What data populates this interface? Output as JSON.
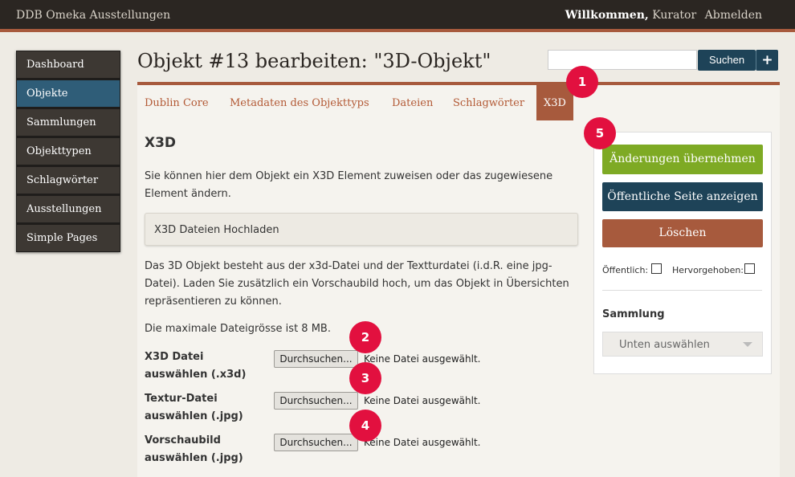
{
  "header": {
    "site_title": "DDB Omeka Ausstellungen",
    "welcome": "Willkommen,",
    "user": "Kurator",
    "logout": "Abmelden"
  },
  "nav": {
    "items": [
      {
        "label": "Dashboard",
        "active": false
      },
      {
        "label": "Objekte",
        "active": true
      },
      {
        "label": "Sammlungen",
        "active": false
      },
      {
        "label": "Objekttypen",
        "active": false
      },
      {
        "label": "Schlagwörter",
        "active": false
      },
      {
        "label": "Ausstellungen",
        "active": false
      },
      {
        "label": "Simple Pages",
        "active": false
      }
    ]
  },
  "page": {
    "title": "Objekt #13 bearbeiten: \"3D-Objekt\""
  },
  "search": {
    "value": "",
    "button": "Suchen",
    "add": "+"
  },
  "tabs": [
    {
      "label": "Dublin Core",
      "active": false
    },
    {
      "label": "Metadaten des Objekttyps",
      "active": false
    },
    {
      "label": "Dateien",
      "active": false
    },
    {
      "label": "Schlagwörter",
      "active": false
    },
    {
      "label": "X3D",
      "active": true
    }
  ],
  "content": {
    "heading": "X3D",
    "intro": "Sie können hier dem Objekt ein X3D Element zuweisen oder das zugewiesene Element ändern.",
    "upload_box": "X3D Dateien Hochladen",
    "description": "Das 3D Objekt besteht aus der x3d-Datei und der Textturdatei (i.d.R. eine jpg-Datei). Laden Sie zusätzlich ein Vorschaubild hoch, um das Objekt in Übersichten repräsentieren zu können.",
    "max_size": "Die maximale Dateigrösse ist 8 MB.",
    "fields": [
      {
        "label": "X3D Datei auswählen (.x3d)",
        "button": "Durchsuchen...",
        "status": "Keine Datei ausgewählt."
      },
      {
        "label": "Textur-Datei auswählen (.jpg)",
        "button": "Durchsuchen...",
        "status": "Keine Datei ausgewählt."
      },
      {
        "label": "Vorschaubild auswählen (.jpg)",
        "button": "Durchsuchen...",
        "status": "Keine Datei ausgewählt."
      }
    ]
  },
  "sidebar": {
    "save": "Änderungen übernehmen",
    "view_public": "Öffentliche Seite anzeigen",
    "delete": "Löschen",
    "public_label": "Öffentlich:",
    "featured_label": "Hervorgehoben:",
    "collection_heading": "Sammlung",
    "collection_select": "Unten auswählen"
  },
  "badges": [
    "1",
    "2",
    "3",
    "4",
    "5"
  ],
  "colors": {
    "topbar": "#2b2622",
    "accent_brown": "#a75a3d",
    "nav_active": "#2f5d78",
    "navy": "#1e4358",
    "green": "#7eaa24",
    "badge": "#e2103f"
  }
}
